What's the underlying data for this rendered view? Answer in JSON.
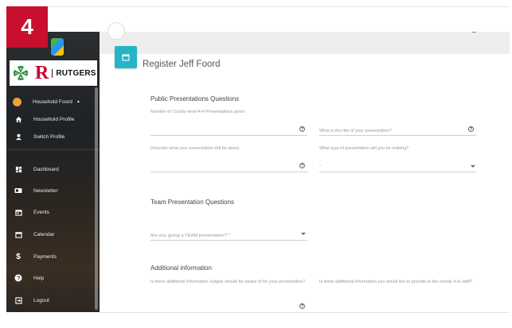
{
  "step_badge": "4",
  "app": {
    "logo_text": "RUTGERS",
    "logo_letter": "R"
  },
  "sidebar": {
    "user": "Household Foord",
    "user_items": [
      {
        "label": "Household Profile",
        "icon": "home-icon"
      },
      {
        "label": "Switch Profile",
        "icon": "person-icon"
      }
    ],
    "items": [
      {
        "label": "Dashboard",
        "icon": "dashboard-icon"
      },
      {
        "label": "Newsletter",
        "icon": "newsletter-icon"
      },
      {
        "label": "Events",
        "icon": "events-icon"
      },
      {
        "label": "Calendar",
        "icon": "calendar-icon"
      },
      {
        "label": "Payments",
        "icon": "dollar-icon"
      },
      {
        "label": "Help",
        "icon": "help-icon"
      },
      {
        "label": "Logout",
        "icon": "logout-icon"
      }
    ]
  },
  "header": {
    "title": "Register Jeff Foord"
  },
  "form": {
    "public": {
      "title": "Public Presentations Questions",
      "q1_label": "Number of County-level 4-H Presentations given:",
      "q2_label": "What is the title of your presentation?",
      "q3_label": "Describe what your presentation will be about.",
      "q4_label": "What type of presentation will you be making?",
      "q4_value": "-"
    },
    "team": {
      "title": "Team Presentation Questions",
      "q1_label": "Are you giving a TEAM presentation? *"
    },
    "additional": {
      "title": "Additional information",
      "q1_label": "Is there additional information Judges should be aware of for your presentation?",
      "q2_label": "Is there additional information you would like to provide to the county 4-H staff?"
    }
  }
}
